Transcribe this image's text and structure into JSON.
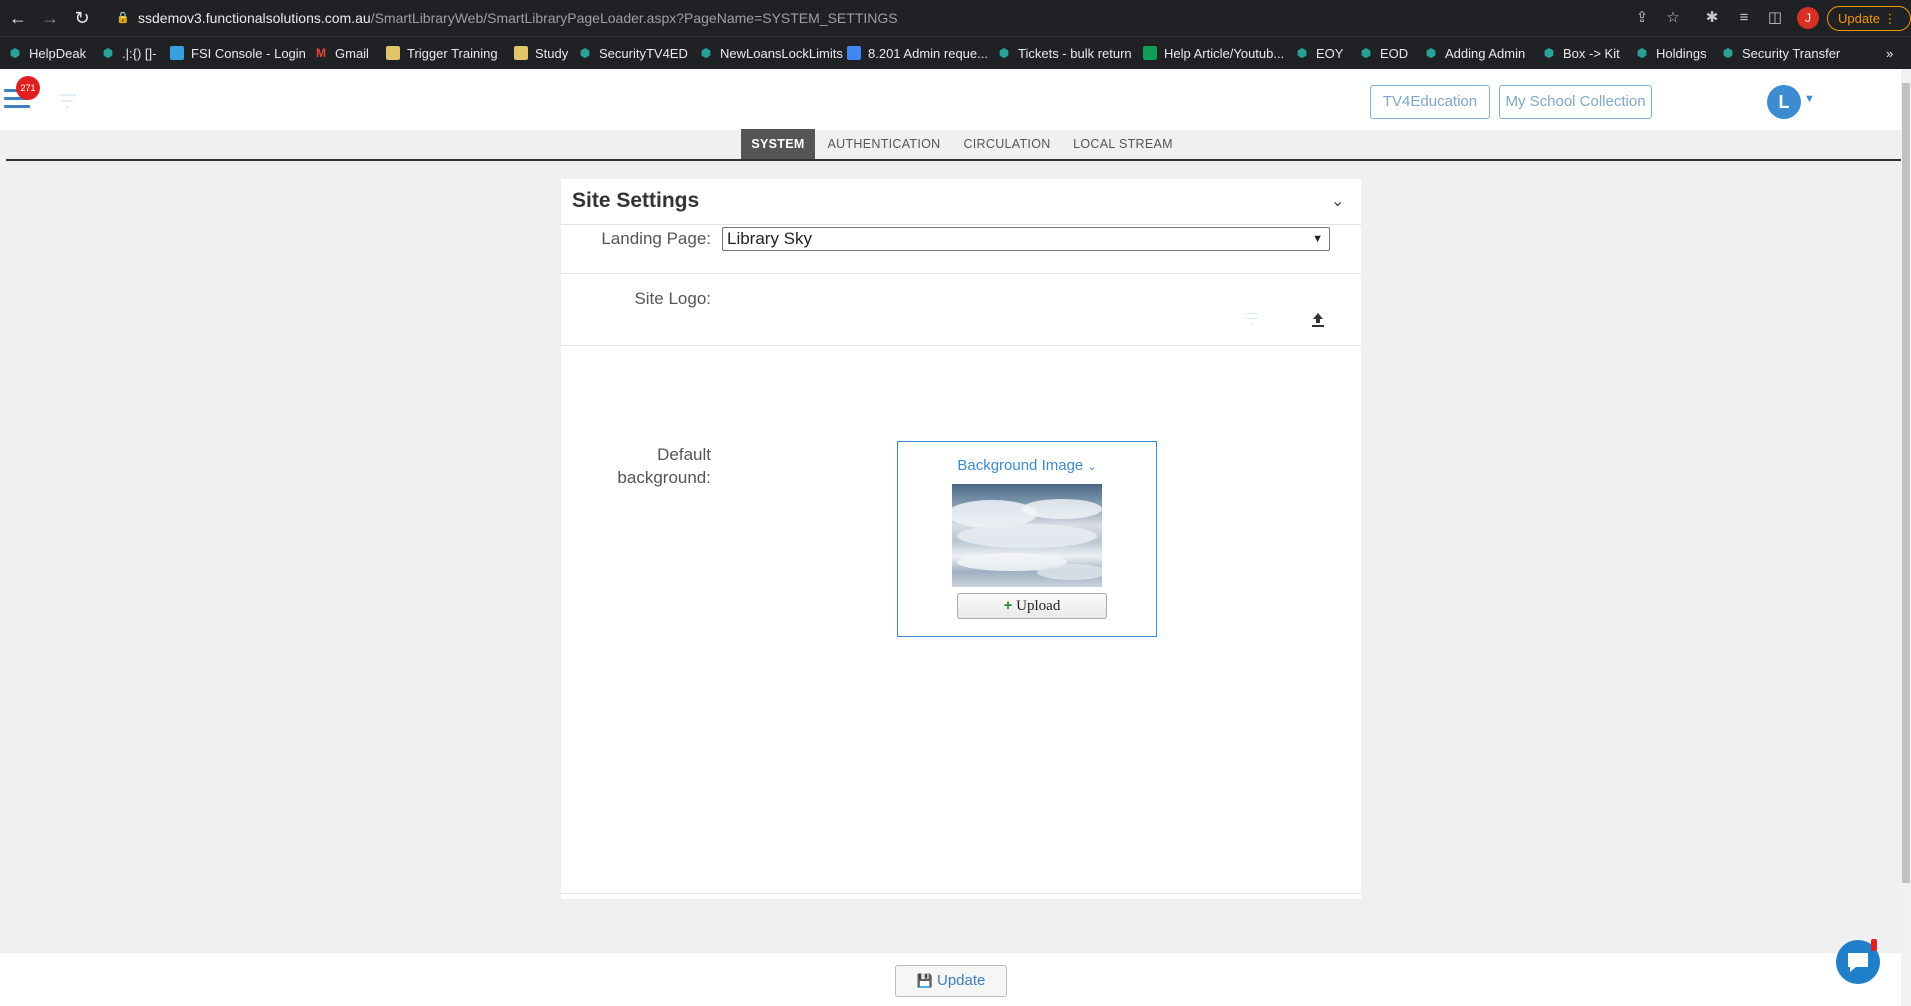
{
  "browser": {
    "url_host": "ssdemov3.functionalsolutions.com.au",
    "url_path": "/SmartLibraryWeb/SmartLibraryPageLoader.aspx?PageName=SYSTEM_SETTINGS",
    "update_label": "Update",
    "profile_initial": "J",
    "bookmarks": [
      {
        "label": "HelpDeak",
        "icon": "globe-icon"
      },
      {
        "label": ".|:{) []-",
        "icon": "globe-icon"
      },
      {
        "label": "FSI Console - Login",
        "icon": "fsi-icon"
      },
      {
        "label": "Gmail",
        "icon": "gmail-icon"
      },
      {
        "label": "Trigger Training",
        "icon": "folder-icon"
      },
      {
        "label": "Study",
        "icon": "folder-icon"
      },
      {
        "label": "SecurityTV4ED",
        "icon": "globe-icon"
      },
      {
        "label": "NewLoansLockLimits",
        "icon": "globe-icon"
      },
      {
        "label": "8.201 Admin reque...",
        "icon": "doc-icon"
      },
      {
        "label": "Tickets - bulk return",
        "icon": "globe-icon"
      },
      {
        "label": "Help Article/Youtub...",
        "icon": "sheet-icon"
      },
      {
        "label": "EOY",
        "icon": "globe-icon"
      },
      {
        "label": "EOD",
        "icon": "globe-icon"
      },
      {
        "label": "Adding Admin",
        "icon": "globe-icon"
      },
      {
        "label": "Box -> Kit",
        "icon": "globe-icon"
      },
      {
        "label": "Holdings",
        "icon": "globe-icon"
      },
      {
        "label": "Security Transfer",
        "icon": "globe-icon"
      }
    ]
  },
  "header": {
    "notification_count": "271",
    "btn_tv4education": "TV4Education",
    "btn_my_school_collection": "My School Collection",
    "user_initial": "L"
  },
  "tabs": [
    {
      "label": "SYSTEM",
      "active": true
    },
    {
      "label": "AUTHENTICATION",
      "active": false
    },
    {
      "label": "CIRCULATION",
      "active": false
    },
    {
      "label": "LOCAL STREAM",
      "active": false
    }
  ],
  "panel": {
    "title": "Site Settings",
    "landing_label": "Landing Page:",
    "landing_value": "Library Sky",
    "logo_label": "Site Logo:",
    "bg_label_line1": "Default",
    "bg_label_line2": "background:",
    "bg_dropdown": "Background Image",
    "upload_label": "Upload"
  },
  "footer": {
    "update_label": "Update"
  },
  "colors": {
    "accent": "#3d8bd0",
    "active_tab_bg": "#555555",
    "badge": "#e02020"
  }
}
